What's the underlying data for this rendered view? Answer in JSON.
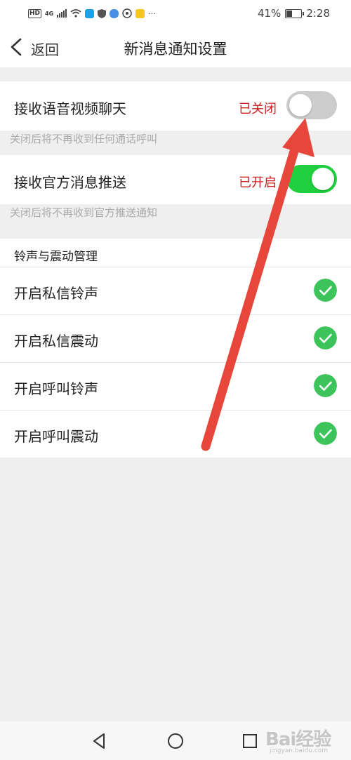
{
  "status_bar": {
    "network_hd": "HD",
    "network_gen": "4G",
    "more": "···",
    "battery_percent": "41%",
    "battery_level": 0.41,
    "time": "2:28"
  },
  "header": {
    "back_label": "返回",
    "title": "新消息通知设置"
  },
  "settings": {
    "voice_video": {
      "label": "接收语音视频聊天",
      "status": "已关闭",
      "enabled": false,
      "hint": "关闭后将不再收到任何通话呼叫"
    },
    "official_push": {
      "label": "接收官方消息推送",
      "status": "已开启",
      "enabled": true,
      "hint": "关闭后将不再收到官方推送通知"
    }
  },
  "ringtone_section": {
    "header": "铃声与震动管理",
    "items": [
      {
        "label": "开启私信铃声",
        "checked": true
      },
      {
        "label": "开启私信震动",
        "checked": true
      },
      {
        "label": "开启呼叫铃声",
        "checked": true
      },
      {
        "label": "开启呼叫震动",
        "checked": true
      }
    ]
  },
  "watermark": {
    "brand": "Bai经验",
    "url": "jingyan.baidu.com"
  },
  "colors": {
    "toggle_on": "#1fcf3d",
    "toggle_off": "#cccccc",
    "status_red": "#cc1f1f",
    "check_green": "#3cc45a",
    "annotation_arrow": "#e8463a"
  },
  "icons": {
    "back": "chevron-left-icon",
    "check": "check-circle-icon",
    "nav_back": "triangle-back-icon",
    "nav_home": "circle-home-icon",
    "nav_recent": "square-recent-icon"
  }
}
